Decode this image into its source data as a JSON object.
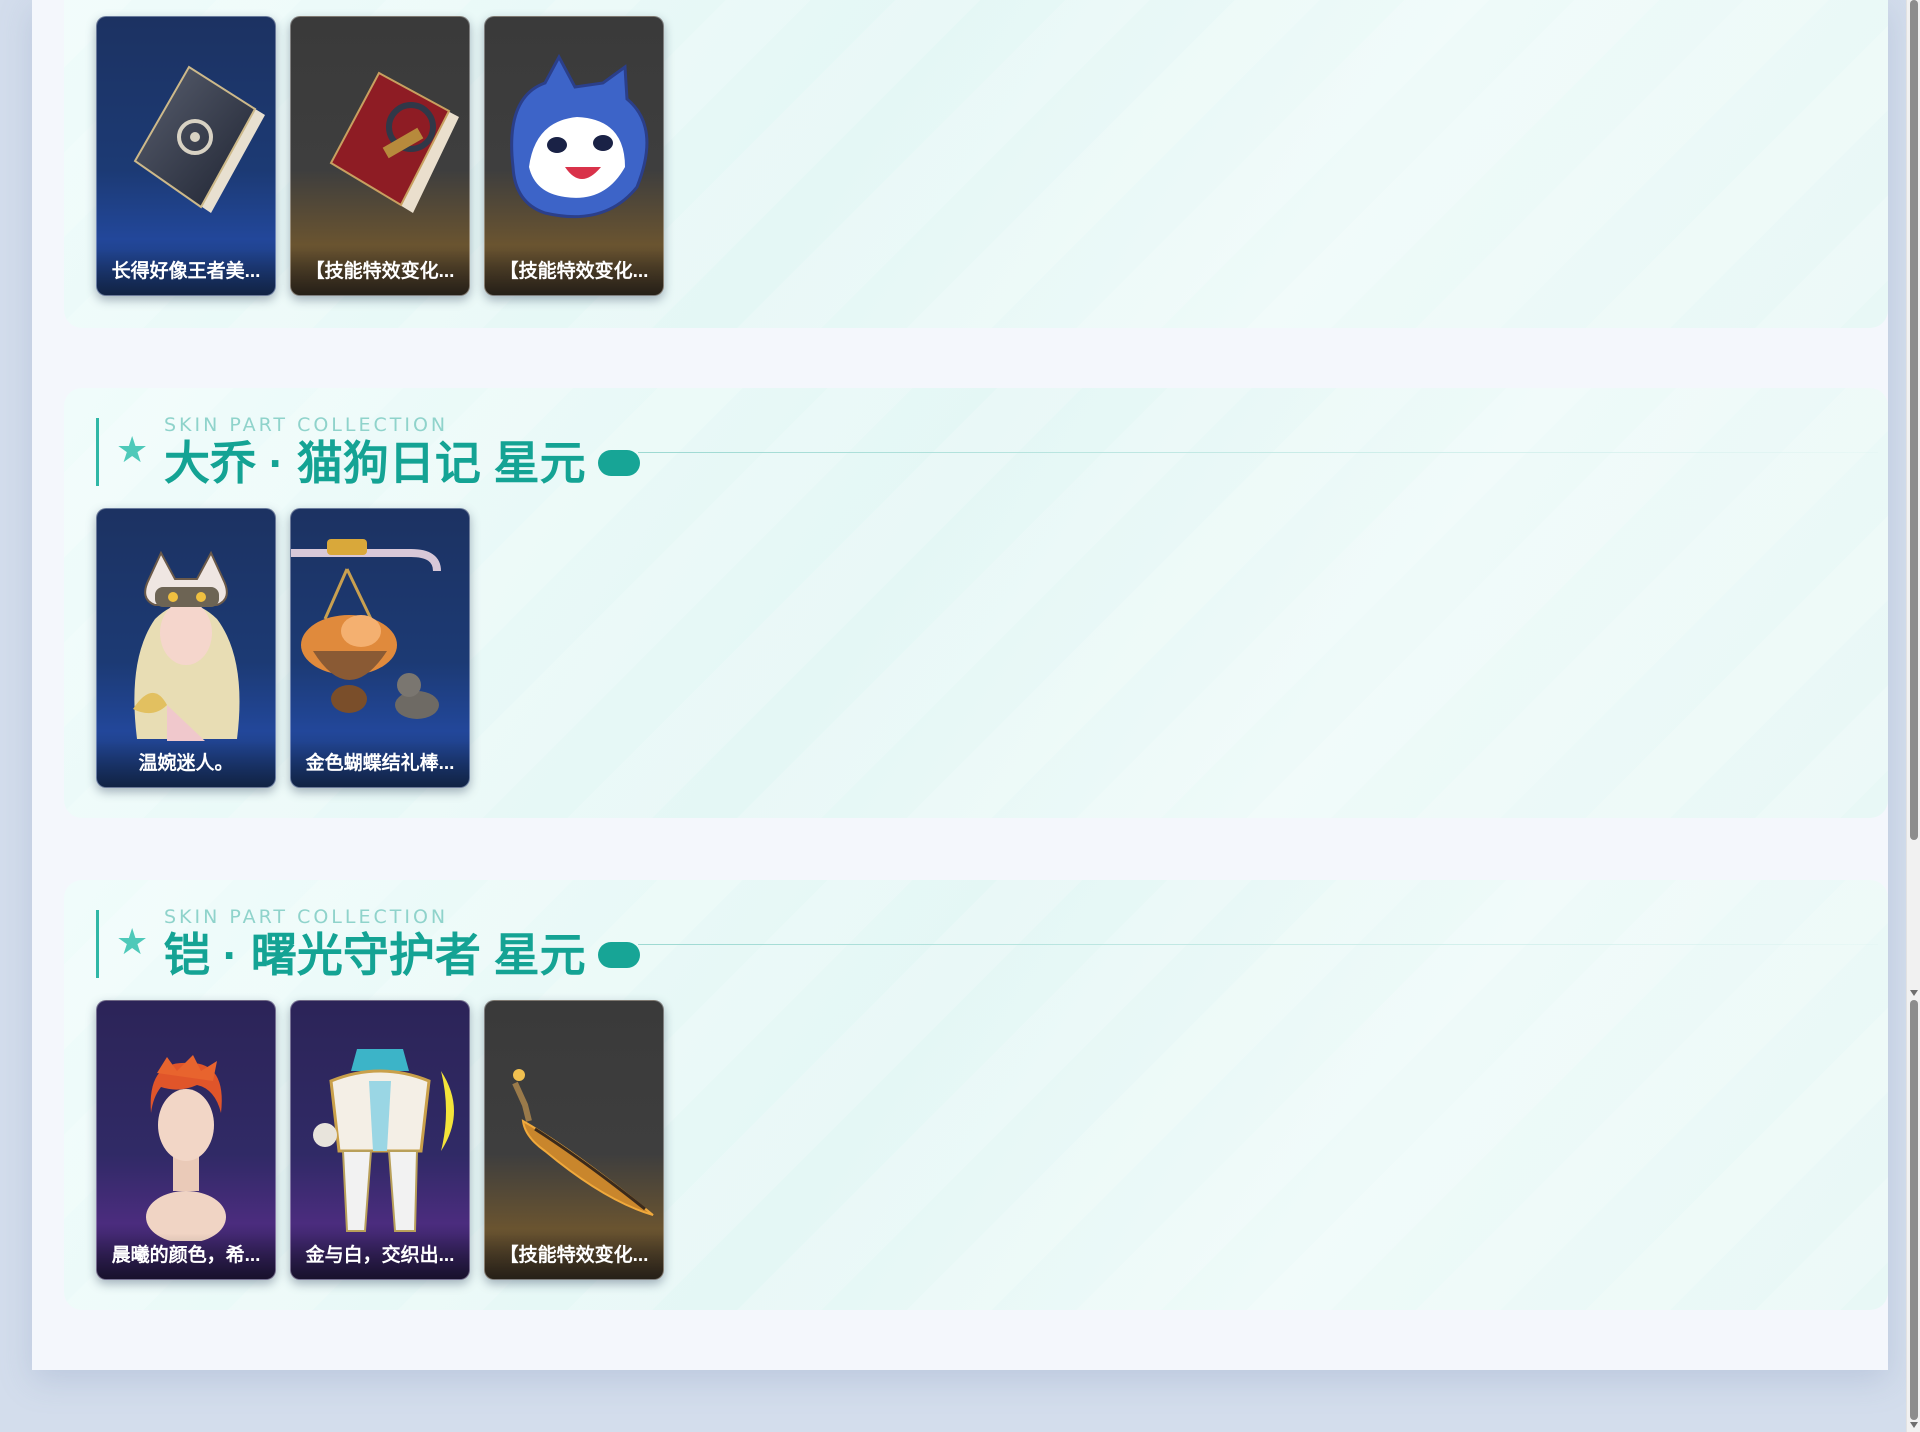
{
  "sections": [
    {
      "subtitle": "",
      "title": "",
      "cards": [
        {
          "label": "长得好像王者美...",
          "theme": "blue",
          "art": "book-icon"
        },
        {
          "label": "【技能特效变化...",
          "theme": "dark",
          "art": "red-book-icon"
        },
        {
          "label": "【技能特效变化...",
          "theme": "dark",
          "art": "cat-mask-icon"
        }
      ]
    },
    {
      "subtitle": "SKIN PART COLLECTION",
      "title": "大乔 · 猫狗日记 星元",
      "cards": [
        {
          "label": "温婉迷人。",
          "theme": "blue",
          "art": "hero-head-icon"
        },
        {
          "label": "金色蝴蝶结礼棒...",
          "theme": "blue",
          "art": "cat-basket-icon"
        }
      ]
    },
    {
      "subtitle": "SKIN PART COLLECTION",
      "title": "铠 · 曙光守护者 星元",
      "cards": [
        {
          "label": "晨曦的颜色，希...",
          "theme": "purple",
          "art": "hero-head-icon"
        },
        {
          "label": "金与白，交织出...",
          "theme": "purple",
          "art": "armor-body-icon"
        },
        {
          "label": "【技能特效变化...",
          "theme": "dark",
          "art": "blade-icon"
        }
      ]
    }
  ],
  "colors": {
    "accent": "#14a394",
    "accent_light": "#4ec9b9",
    "page_bg": "#d3ddec",
    "panel_bg": "#f4f7fc"
  }
}
